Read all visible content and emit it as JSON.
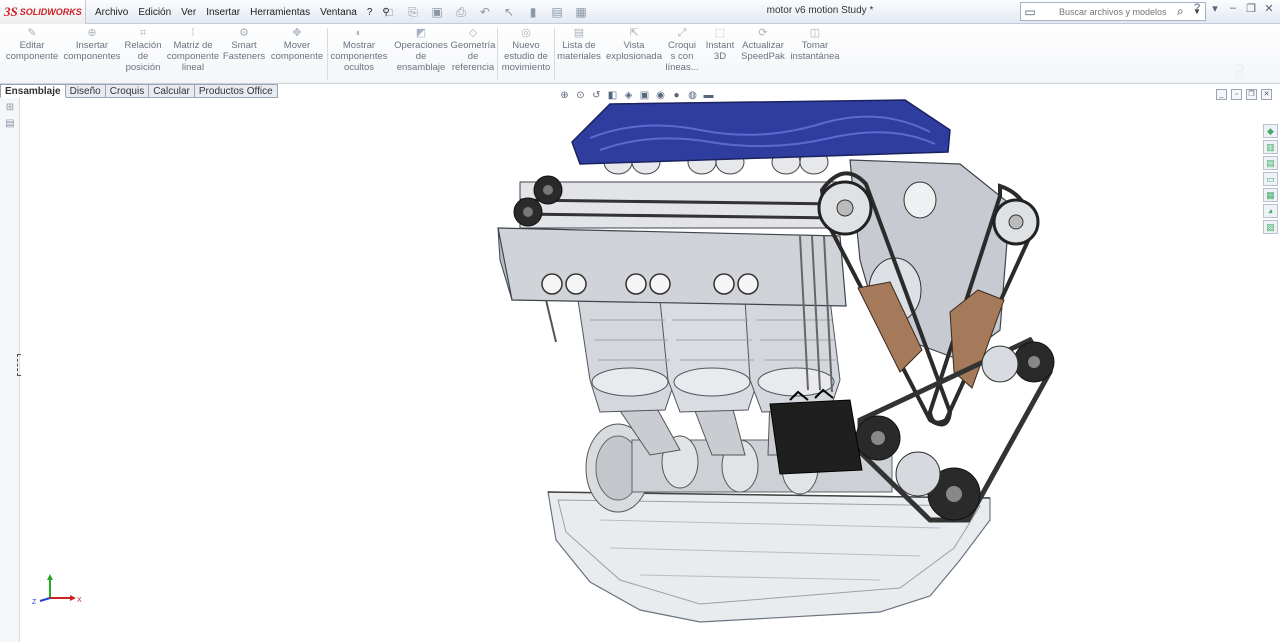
{
  "app": {
    "brand": "SOLIDWORKS",
    "ds": "3S",
    "document_title": "motor v6 motion Study *"
  },
  "menu": [
    "Archivo",
    "Edición",
    "Ver",
    "Insertar",
    "Herramientas",
    "Ventana",
    "?"
  ],
  "search": {
    "placeholder": "Buscar archivos y modelos"
  },
  "ribbon": [
    {
      "label": "Editar\ncomponente",
      "icon": "edit-component-icon"
    },
    {
      "label": "Insertar\ncomponentes",
      "icon": "insert-components-icon"
    },
    {
      "label": "Relación\nde\nposición",
      "icon": "mate-icon"
    },
    {
      "label": "Matriz de\ncomponente\nlineal",
      "icon": "linear-pattern-icon"
    },
    {
      "label": "Smart\nFasteners",
      "icon": "smart-fasteners-icon"
    },
    {
      "label": "Mover\ncomponente",
      "icon": "move-component-icon"
    },
    {
      "label": "Mostrar\ncomponentes\nocultos",
      "icon": "show-hidden-icon"
    },
    {
      "label": "Operaciones\nde\nensamblaje",
      "icon": "assembly-features-icon"
    },
    {
      "label": "Geometría\nde\nreferencia",
      "icon": "reference-geometry-icon"
    },
    {
      "label": "Nuevo\nestudio de\nmovimiento",
      "icon": "motion-study-icon"
    },
    {
      "label": "Lista de\nmateriales",
      "icon": "bom-icon"
    },
    {
      "label": "Vista\nexplosionada",
      "icon": "exploded-view-icon"
    },
    {
      "label": "Croqui\ns con\nlíneas...",
      "icon": "explode-line-sketch-icon"
    },
    {
      "label": "Instant\n3D",
      "icon": "instant3d-icon"
    },
    {
      "label": "Actualizar\nSpeedPak",
      "icon": "speedpak-icon"
    },
    {
      "label": "Tomar\ninstantánea",
      "icon": "snapshot-icon"
    }
  ],
  "tabs": [
    "Ensamblaje",
    "Diseño",
    "Croquis",
    "Calcular",
    "Productos Office"
  ],
  "colors": {
    "valve_cover": "#2f3e9e",
    "brand_red": "#d11f26",
    "tensioner": "#a47a5a",
    "triad_x": "#cc2222",
    "triad_y": "#22aa22",
    "triad_z": "#2244cc"
  }
}
